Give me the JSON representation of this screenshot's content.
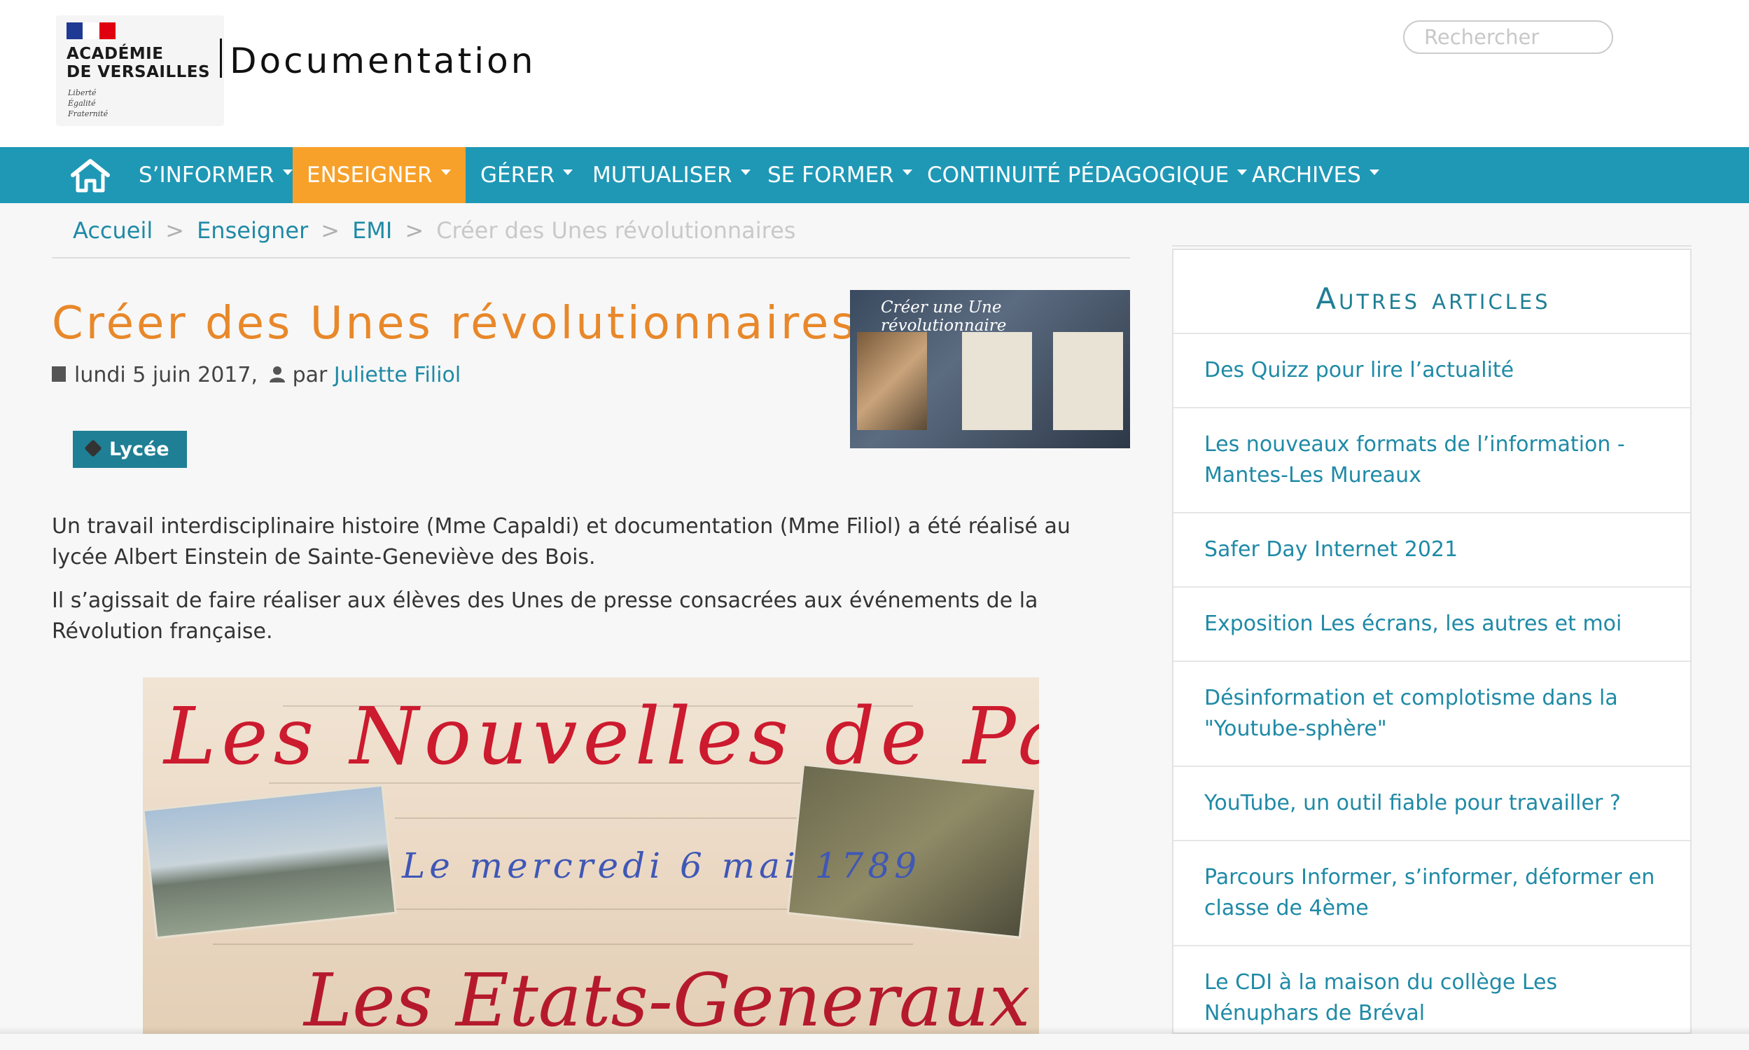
{
  "header": {
    "logo": {
      "line1": "ACADÉMIE",
      "line2": "DE VERSAILLES",
      "motto": [
        "Liberté",
        "Égalité",
        "Fraternité"
      ]
    },
    "site_title": "Documentation",
    "search": {
      "placeholder": "Rechercher",
      "value": ""
    }
  },
  "nav": {
    "items": [
      {
        "label": "S’INFORMER"
      },
      {
        "label": "ENSEIGNER",
        "active": true
      },
      {
        "label": "GÉRER"
      },
      {
        "label": "MUTUALISER"
      },
      {
        "label": "SE FORMER"
      },
      {
        "label": "CONTINUITÉ PÉDAGOGIQUE"
      },
      {
        "label": "ARCHIVES"
      }
    ]
  },
  "breadcrumb": {
    "items": [
      "Accueil",
      "Enseigner",
      "EMI"
    ],
    "current": "Créer des Unes révolutionnaires",
    "separator": ">"
  },
  "article": {
    "title": "Créer des Unes révolutionnaires",
    "date": "lundi 5 juin 2017,",
    "by": "par",
    "author": "Juliette Filiol",
    "tag": "Lycée",
    "thumbnail_caption": "Créer une Une révolutionnaire",
    "paragraphs": [
      "Un travail interdisciplinaire histoire (Mme Capaldi) et documentation (Mme Filiol) a été réalisé au lycée Albert Einstein de Sainte-Geneviève des Bois.",
      "Il s’agissait de faire réaliser aux élèves des Unes de presse consacrées aux événements de la Révolution française."
    ],
    "image": {
      "title": "Les Nouvelles de Paris",
      "date": "Le mercredi 6 mai 1789",
      "subtitle": "Les Etats-Generaux"
    }
  },
  "sidebar": {
    "title": "Autres articles",
    "items": [
      "Des Quizz pour lire l’actualité",
      "Les nouveaux formats de l’information - Mantes-Les Mureaux",
      "Safer Day Internet 2021",
      "Exposition Les écrans, les autres et moi",
      "Désinformation et complotisme dans la \"Youtube-sphère\"",
      "YouTube, un outil fiable pour travailler ?",
      "Parcours Informer, s’informer, déformer en classe de 4ème",
      "Le CDI à la maison du collège Les Nénuphars de Bréval"
    ]
  },
  "colors": {
    "nav": "#1f98b6",
    "active": "#f7a12a",
    "title": "#e8882a",
    "link": "#1f8aa6",
    "tag": "#1f7f94"
  }
}
